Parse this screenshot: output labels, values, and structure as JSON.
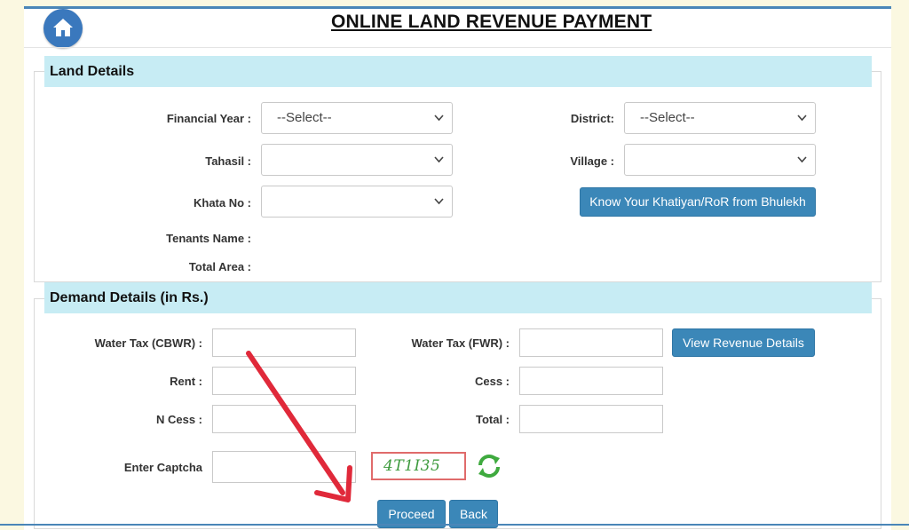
{
  "header": {
    "title": "ONLINE LAND REVENUE PAYMENT",
    "home_icon": "home-icon"
  },
  "land_details": {
    "heading": "Land Details",
    "financial_year": {
      "label": "Financial Year :",
      "value": "--Select--"
    },
    "district": {
      "label": "District:",
      "value": "--Select--"
    },
    "tahasil": {
      "label": "Tahasil :",
      "value": ""
    },
    "village": {
      "label": "Village :",
      "value": ""
    },
    "khata_no": {
      "label": "Khata No :",
      "value": ""
    },
    "know_button": "Know Your Khatiyan/RoR from Bhulekh",
    "tenants_name_label": "Tenants Name :",
    "total_area_label": "Total Area :"
  },
  "demand_details": {
    "heading": "Demand Details (in Rs.)",
    "water_tax_cbwr_label": "Water Tax (CBWR) :",
    "water_tax_fwr_label": "Water Tax (FWR) :",
    "view_revenue_button": "View Revenue Details",
    "rent_label": "Rent :",
    "cess_label": "Cess :",
    "n_cess_label": "N Cess :",
    "total_label": "Total :",
    "captcha_label": "Enter Captcha",
    "captcha_text": "4T1I35",
    "refresh_icon": "refresh-icon"
  },
  "actions": {
    "proceed": "Proceed",
    "back": "Back"
  },
  "colors": {
    "accent": "#3b87b8",
    "section_header": "#c7ecf4",
    "page_bg": "#fbf8e1",
    "annotation_arrow": "#e0293a"
  }
}
